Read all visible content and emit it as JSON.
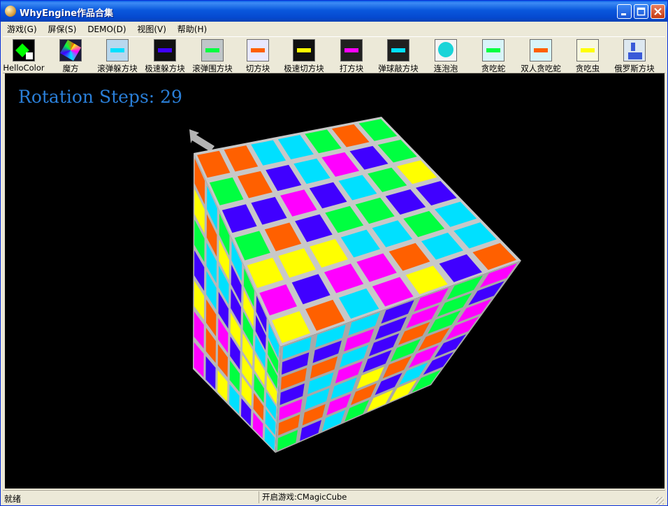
{
  "window": {
    "title": "WhyEngine作品合集"
  },
  "menu": [
    "游戏(G)",
    "屏保(S)",
    "DEMO(D)",
    "视图(V)",
    "帮助(H)"
  ],
  "toolbar": [
    {
      "label": "HelloColor",
      "icon": "hellocolor-icon"
    },
    {
      "label": "魔方",
      "icon": "magic-cube-icon"
    },
    {
      "label": "滚弹躲方块",
      "icon": "bounce-dodge-icon"
    },
    {
      "label": "极速躲方块",
      "icon": "speed-dodge-icon"
    },
    {
      "label": "滚弹围方块",
      "icon": "bounce-surround-icon"
    },
    {
      "label": "切方块",
      "icon": "cut-block-icon"
    },
    {
      "label": "极速切方块",
      "icon": "speed-cut-icon"
    },
    {
      "label": "打方块",
      "icon": "hit-block-icon"
    },
    {
      "label": "弹球敲方块",
      "icon": "breakout-icon"
    },
    {
      "label": "连泡泡",
      "icon": "bubble-icon"
    },
    {
      "label": "贪吃蛇",
      "icon": "snake-icon"
    },
    {
      "label": "双人贪吃蛇",
      "icon": "two-player-snake-icon"
    },
    {
      "label": "贪吃虫",
      "icon": "worm-icon"
    },
    {
      "label": "俄罗斯方块",
      "icon": "tetris-icon"
    }
  ],
  "scene": {
    "rotation_label": "Rotation Steps: 29",
    "cube_size": 7,
    "colors": [
      "#ffff00",
      "#ff00ff",
      "#00e0ff",
      "#4000ff",
      "#00ff40",
      "#ff6000"
    ],
    "text_color": "#2a7fd8",
    "background": "#000000"
  },
  "status": {
    "left": "就绪",
    "middle": "开启游戏:CMagicCube"
  }
}
